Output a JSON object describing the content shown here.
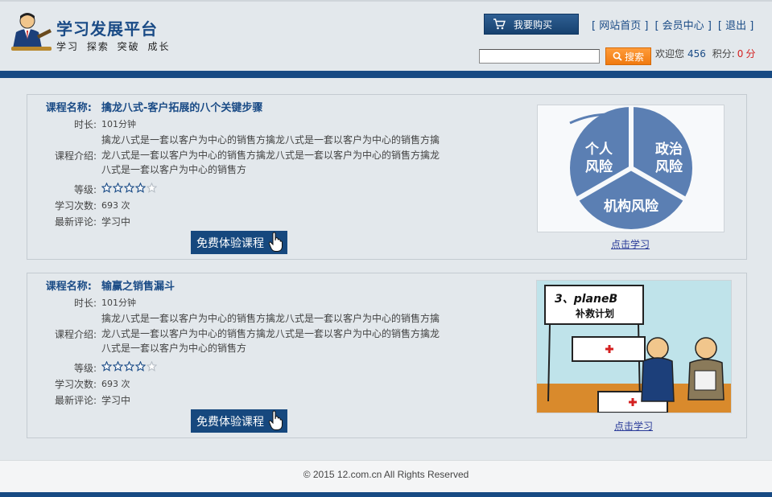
{
  "header": {
    "brand_title": "学习发展平台",
    "brand_subtitle": "学习 探索 突破 成长",
    "buy_button": "我要购买",
    "links": [
      "网站首页",
      "会员中心",
      "退出"
    ],
    "search": {
      "value": "",
      "button": "搜索"
    },
    "welcome": {
      "prefix": "欢迎您",
      "user_id": "456",
      "points_label": "积分:",
      "points": "0",
      "points_unit": "分"
    }
  },
  "labels": {
    "course_name": "课程名称:",
    "duration": "时长:",
    "intro": "课程介绍:",
    "level": "等级:",
    "study_count": "学习次数:",
    "latest_comment": "最新评论:"
  },
  "courses": [
    {
      "name": "擒龙八式-客户拓展的八个关键步骤",
      "duration": "101分钟",
      "intro": "擒龙八式是一套以客户为中心的销售方擒龙八式是一套以客户为中心的销售方擒龙八式是一套以客户为中心的销售方擒龙八式是一套以客户为中心的销售方擒龙八式是一套以客户为中心的销售方",
      "rating": 4,
      "rating_max": 5,
      "study_count": "693 次",
      "latest_comment": "学习中",
      "button": "免费体验课程",
      "link": "点击学习",
      "image_text": [
        "个人",
        "风险",
        "政治",
        "风险",
        "机构风险"
      ]
    },
    {
      "name": "输赢之销售漏斗",
      "duration": "101分钟",
      "intro": "擒龙八式是一套以客户为中心的销售方擒龙八式是一套以客户为中心的销售方擒龙八式是一套以客户为中心的销售方擒龙八式是一套以客户为中心的销售方擒龙八式是一套以客户为中心的销售方",
      "rating": 4,
      "rating_max": 5,
      "study_count": "693 次",
      "latest_comment": "学习中",
      "button": "免费体验课程",
      "link": "点击学习",
      "image_text": [
        "3、planeB",
        "补救计划"
      ]
    }
  ],
  "footer": {
    "copyright": "© 2015 12.com.cn All Rights Reserved"
  },
  "colors": {
    "brand_blue": "#174a83",
    "search_orange": "#f07a10",
    "points_red": "#d42020"
  }
}
